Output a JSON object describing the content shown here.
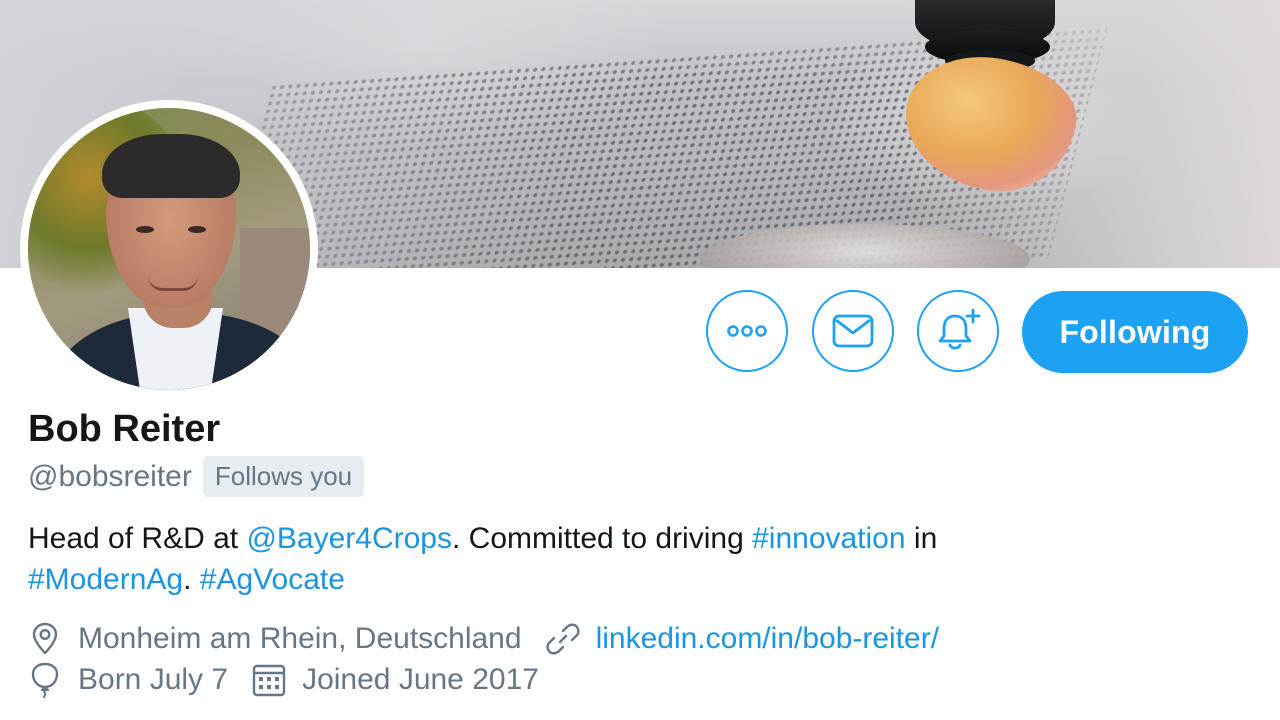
{
  "banner": {
    "alt": "Profile banner"
  },
  "profile": {
    "name": "Bob Reiter",
    "handle": "@bobsreiter",
    "follows_you": "Follows you",
    "bio": {
      "t1": "Head of R&D at ",
      "mention": "@Bayer4Crops",
      "t2": ". Committed to driving ",
      "tag1": "#innovation",
      "t3": " in",
      "tag2": "#ModernAg",
      "t4": ". ",
      "tag3": "#AgVocate"
    },
    "location": "Monheim am Rhein, Deutschland",
    "website": "linkedin.com/in/bob-reiter/",
    "birthday": "Born July 7",
    "joined": "Joined June 2017"
  },
  "actions": {
    "more_icon": "more-dots-icon",
    "message_icon": "envelope-icon",
    "notify_icon": "bell-plus-icon",
    "following_label": "Following"
  },
  "colors": {
    "accent": "#1da1f2",
    "link": "#1b95e0",
    "secondary_text": "#657786",
    "badge_bg": "#e6ecf0"
  }
}
